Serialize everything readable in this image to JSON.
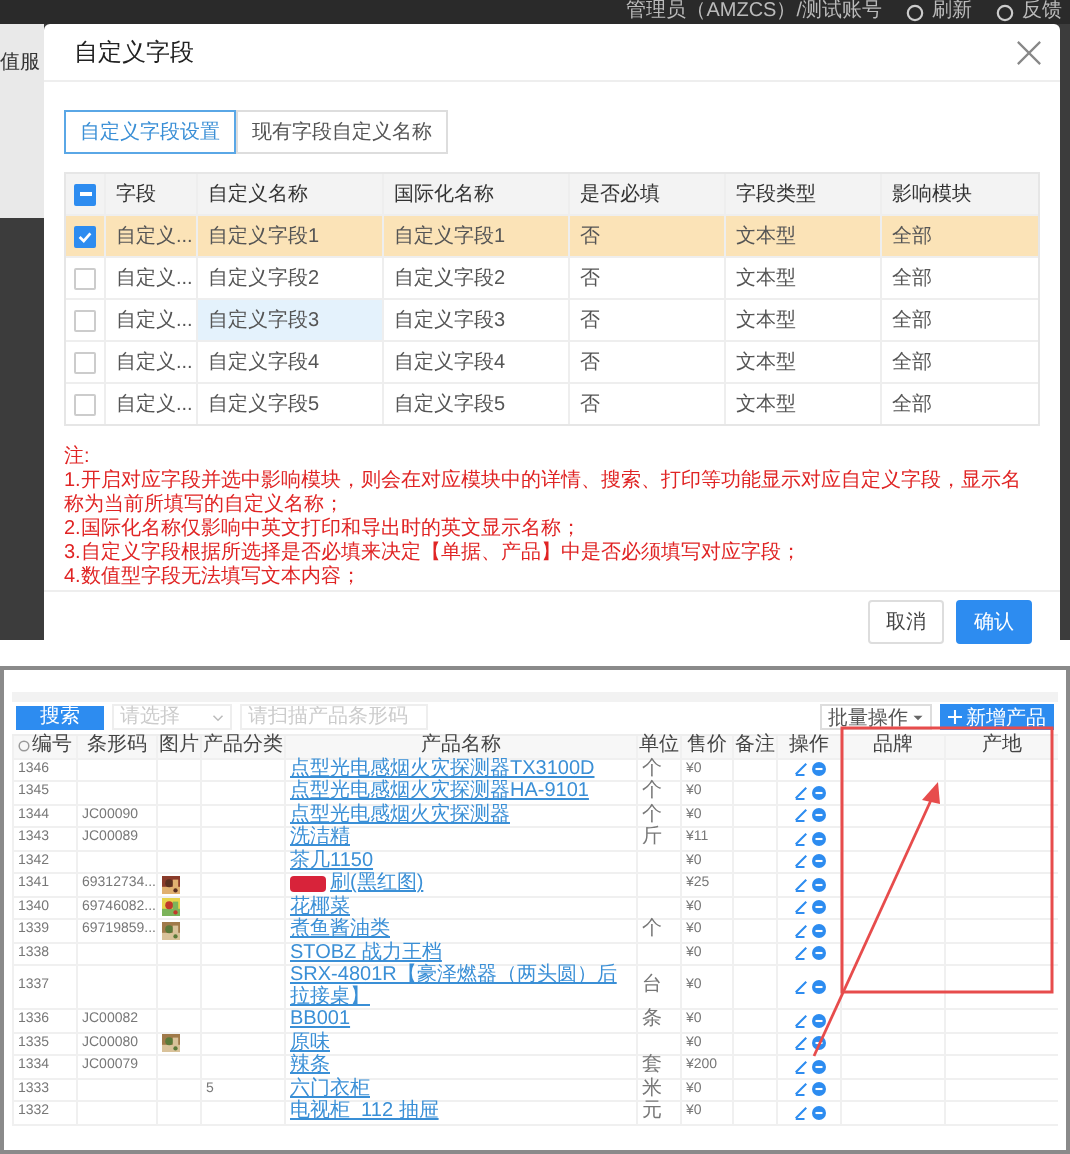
{
  "background": {
    "user": "管理员（AMZCS）/测试账号",
    "refresh": "刷新",
    "feedback": "反馈",
    "side_label": "值服"
  },
  "dialog": {
    "title": "自定义字段",
    "tabs": [
      {
        "label": "自定义字段设置",
        "selected": true
      },
      {
        "label": "现有字段自定义名称",
        "selected": false
      }
    ],
    "table": {
      "select_all_partial": true,
      "columns": [
        "字段",
        "自定义名称",
        "国际化名称",
        "是否必填",
        "字段类型",
        "影响模块"
      ],
      "rows": [
        {
          "checked": true,
          "name_focused": false,
          "cells": [
            "自定义...",
            "自定义字段1",
            "自定义字段1",
            "否",
            "文本型",
            "全部"
          ]
        },
        {
          "checked": false,
          "name_focused": false,
          "cells": [
            "自定义...",
            "自定义字段2",
            "自定义字段2",
            "否",
            "文本型",
            "全部"
          ]
        },
        {
          "checked": false,
          "name_focused": true,
          "cells": [
            "自定义...",
            "自定义字段3",
            "自定义字段3",
            "否",
            "文本型",
            "全部"
          ]
        },
        {
          "checked": false,
          "name_focused": false,
          "cells": [
            "自定义...",
            "自定义字段4",
            "自定义字段4",
            "否",
            "文本型",
            "全部"
          ]
        },
        {
          "checked": false,
          "name_focused": false,
          "cells": [
            "自定义...",
            "自定义字段5",
            "自定义字段5",
            "否",
            "文本型",
            "全部"
          ]
        }
      ]
    },
    "notes": {
      "heading": "注:",
      "lines": [
        "1.开启对应字段并选中影响模块，则会在对应模块中的详情、搜索、打印等功能显示对应自定义字段，显示名称为当前所填写的自定义名称；",
        "2.国际化名称仅影响中英文打印和导出时的英文显示名称；",
        "3.自定义字段根据所选择是否必填来决定【单据、产品】中是否必须填写对应字段；",
        "4.数值型字段无法填写文本内容；"
      ]
    },
    "buttons": [
      {
        "label": "取消",
        "kind": "default"
      },
      {
        "label": "确认",
        "kind": "primary"
      }
    ]
  },
  "product_list": {
    "toolbar": {
      "search_button": "搜索",
      "category_placeholder": "请选择",
      "barcode_placeholder": "请扫描产品条形码",
      "batch_button": "批量操作",
      "add_button": "新增产品"
    },
    "columns": [
      "编号",
      "条形码",
      "图片",
      "产品分类",
      "产品名称",
      "单位",
      "售价",
      "备注",
      "操作",
      "品牌",
      "产地"
    ],
    "rows": [
      {
        "id": "1346",
        "name": "点型光电感烟火灾探测器TX3100D",
        "unit": "个",
        "price": "¥0",
        "image": false,
        "redacted": false
      },
      {
        "id": "1345",
        "name": "点型光电感烟火灾探测器HA-9101",
        "unit": "个",
        "price": "¥0",
        "image": false,
        "redacted": false
      },
      {
        "id": "1344",
        "barcode": "JC00090",
        "name": "点型光电感烟火灾探测器",
        "unit": "个",
        "price": "¥0",
        "image": false,
        "redacted": false
      },
      {
        "id": "1343",
        "barcode": "JC00089",
        "name": "洗洁精",
        "unit": "斤",
        "price": "¥11",
        "image": false,
        "redacted": false
      },
      {
        "id": "1342",
        "name": "茶几1150",
        "price": "¥0",
        "image": false,
        "redacted": false
      },
      {
        "id": "1341",
        "barcode": "69312734...",
        "name": "刷(黑红图)",
        "price": "¥25",
        "image": true,
        "redacted": true
      },
      {
        "id": "1340",
        "barcode": "69746082...",
        "name": "花椰菜",
        "price": "¥0",
        "image": true,
        "redacted": false
      },
      {
        "id": "1339",
        "barcode": "69719859...",
        "name": "煮鱼酱油类",
        "unit": "个",
        "price": "¥0",
        "image": true,
        "redacted": false
      },
      {
        "id": "1338",
        "name": "STOBZ 战力王档",
        "price": "¥0",
        "image": false,
        "redacted": false
      },
      {
        "id": "1337",
        "name": "SRX-4801R【豪泽燃器（两头圆）后拉接桌】",
        "unit": "台",
        "price": "¥0",
        "image": false,
        "redacted": false
      },
      {
        "id": "1336",
        "barcode": "JC00082",
        "name": "BB001",
        "unit": "条",
        "price": "¥0",
        "image": false,
        "redacted": false
      },
      {
        "id": "1335",
        "barcode": "JC00080",
        "name": "原味",
        "price": "¥0",
        "image": true,
        "redacted": false
      },
      {
        "id": "1334",
        "barcode": "JC00079",
        "name": "辣条",
        "unit": "套",
        "price": "¥200",
        "image": false,
        "redacted": false
      },
      {
        "id": "1333",
        "category": "5",
        "name": "六门衣柜",
        "unit": "米",
        "price": "¥0",
        "image": false,
        "redacted": false
      },
      {
        "id": "1332",
        "name": "电视柜_112 抽屉",
        "unit": "元",
        "price": "¥0",
        "image": false,
        "redacted": false
      }
    ]
  }
}
